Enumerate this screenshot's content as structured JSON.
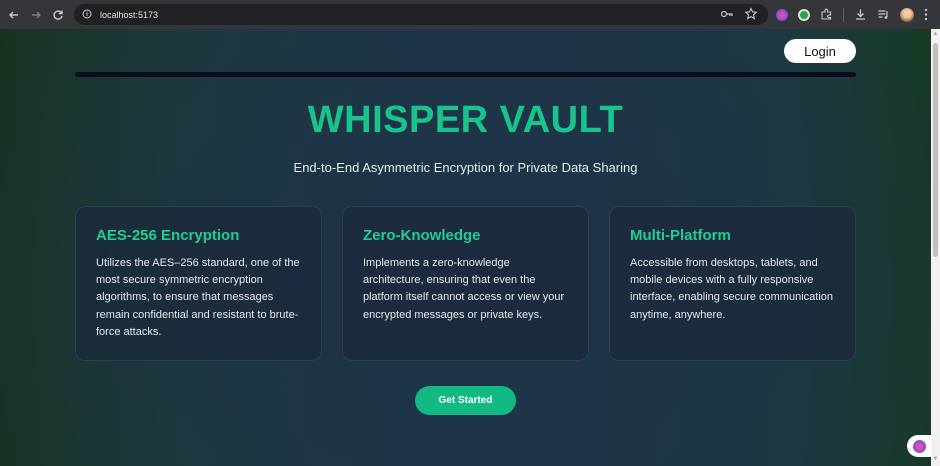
{
  "browser": {
    "url": "localhost:5173"
  },
  "header": {
    "login_label": "Login"
  },
  "hero": {
    "title": "WHISPER VAULT",
    "subtitle": "End-to-End Asymmetric Encryption for Private Data Sharing"
  },
  "features": [
    {
      "title": "AES-256 Encryption",
      "description": "Utilizes the AES–256 standard, one of the most secure symmetric encryption algorithms, to ensure that messages remain confidential and resistant to brute-force attacks."
    },
    {
      "title": "Zero-Knowledge",
      "description": "Implements a zero-knowledge architecture, ensuring that even the platform itself cannot access or view your encrypted messages or private keys."
    },
    {
      "title": "Multi-Platform",
      "description": "Accessible from desktops, tablets, and mobile devices with a fully responsive interface, enabling secure communication anytime, anywhere."
    }
  ],
  "cta": {
    "label": "Get Started"
  },
  "colors": {
    "accent": "#19c48c",
    "button": "#13b982"
  }
}
